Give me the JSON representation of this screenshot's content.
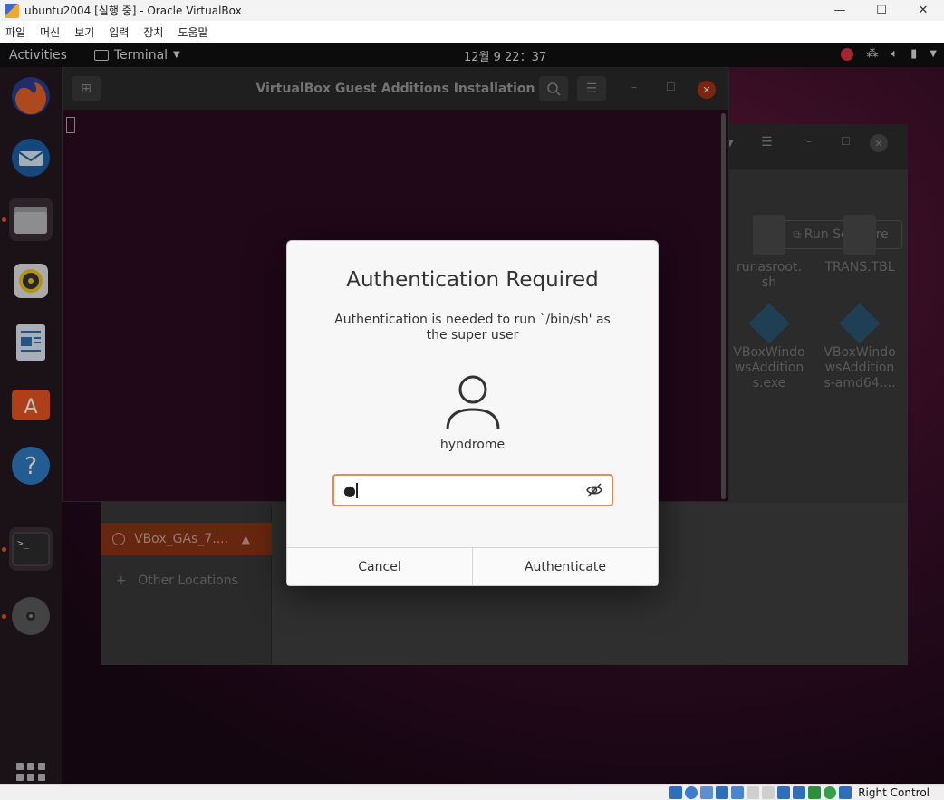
{
  "host": {
    "title": "ubuntu2004 [실행 중] - Oracle VirtualBox",
    "menu": [
      "파일",
      "머신",
      "보기",
      "입력",
      "장치",
      "도움말"
    ],
    "controls": {
      "minimize": "—",
      "maximize": "☐",
      "close": "✕"
    },
    "status_host_key": "Right Control"
  },
  "guest": {
    "topbar": {
      "activities": "Activities",
      "app": "Terminal",
      "clock": "12월 9  22：37"
    },
    "terminal": {
      "title": "VirtualBox Guest Additions Installation"
    },
    "files": {
      "run_software": "Run Software",
      "sidebar_drive": "VBox_GAs_7....",
      "other_locations": "Other Locations",
      "file_items": [
        {
          "name": "runasroot.\nsh"
        },
        {
          "name": "TRANS.TBL"
        },
        {
          "name": "VBoxWindo\nwsAddition\ns.exe"
        },
        {
          "name": "VBoxWindo\nwsAddition\ns-amd64...."
        }
      ]
    }
  },
  "dialog": {
    "title": "Authentication Required",
    "message": "Authentication is needed to run `/bin/sh' as the super user",
    "username": "hyndrome",
    "password_display": "●",
    "cancel_label": "Cancel",
    "authenticate_label": "Authenticate",
    "accent_color": "#e28b55"
  }
}
